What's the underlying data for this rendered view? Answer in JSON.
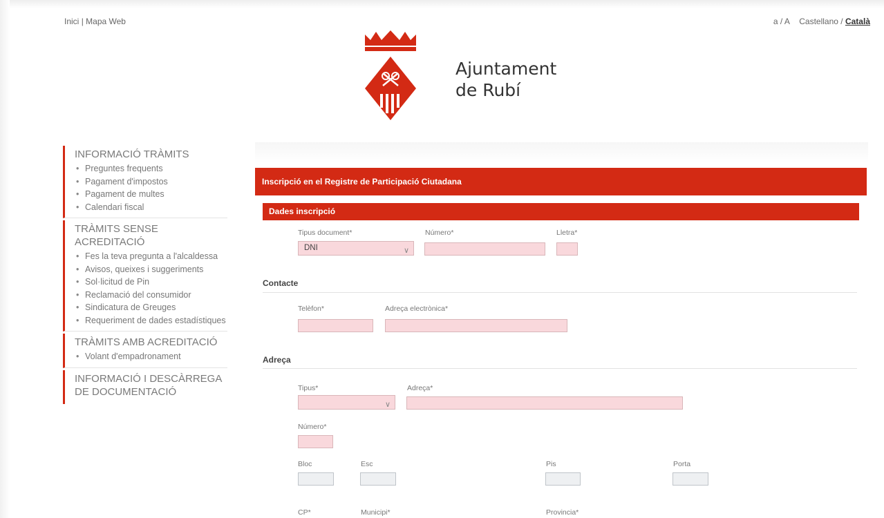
{
  "top_links": {
    "home": "Inici",
    "separator": "|",
    "sitemap": "Mapa Web"
  },
  "lang": {
    "font_toggle": "a / A",
    "castellano": "Castellano",
    "separator": "/",
    "catala": "Català"
  },
  "logo": {
    "line1": "Ajuntament",
    "line2": "de Rubí"
  },
  "sidebar": {
    "sections": [
      {
        "title": "INFORMACIÓ TRÀMITS",
        "items": [
          "Preguntes frequents",
          "Pagament d'impostos",
          "Pagament de multes",
          "Calendari fiscal"
        ]
      },
      {
        "title": "TRÀMITS SENSE ACREDITACIÓ",
        "items": [
          "Fes la teva pregunta a l'alcaldessa",
          "Avisos, queixes i suggeriments",
          "Sol·licitud de Pin",
          "Reclamació del consumidor",
          "Sindicatura de Greuges",
          "Requeriment de dades estadístiques"
        ]
      },
      {
        "title": "TRÀMITS AMB ACREDITACIÓ",
        "items": [
          "Volant d'empadronament"
        ]
      },
      {
        "title": "INFORMACIÓ I DESCÀRREGA DE DOCUMENTACIÓ",
        "items": []
      }
    ]
  },
  "form": {
    "title": "Inscripció en el Registre de Participació Ciutadana",
    "section_title": "Dades inscripció",
    "doc": {
      "type_label": "Tipus document*",
      "type_value": "DNI",
      "number_label": "Número*",
      "letter_label": "Lletra*"
    },
    "contact": {
      "heading": "Contacte",
      "phone_label": "Telèfon*",
      "email_label": "Adreça electrònica*"
    },
    "address": {
      "heading": "Adreça",
      "type_label": "Tipus*",
      "address_label": "Adreça*",
      "number_label": "Número*",
      "block_label": "Bloc",
      "stair_label": "Esc",
      "floor_label": "Pis",
      "door_label": "Porta",
      "cp_label": "CP*",
      "municipality_label": "Municipi*",
      "province_label": "Provincia*"
    }
  },
  "colors": {
    "accent": "#d32a14",
    "required_field": "#f9d8dc",
    "optional_field": "#eef0f2"
  }
}
